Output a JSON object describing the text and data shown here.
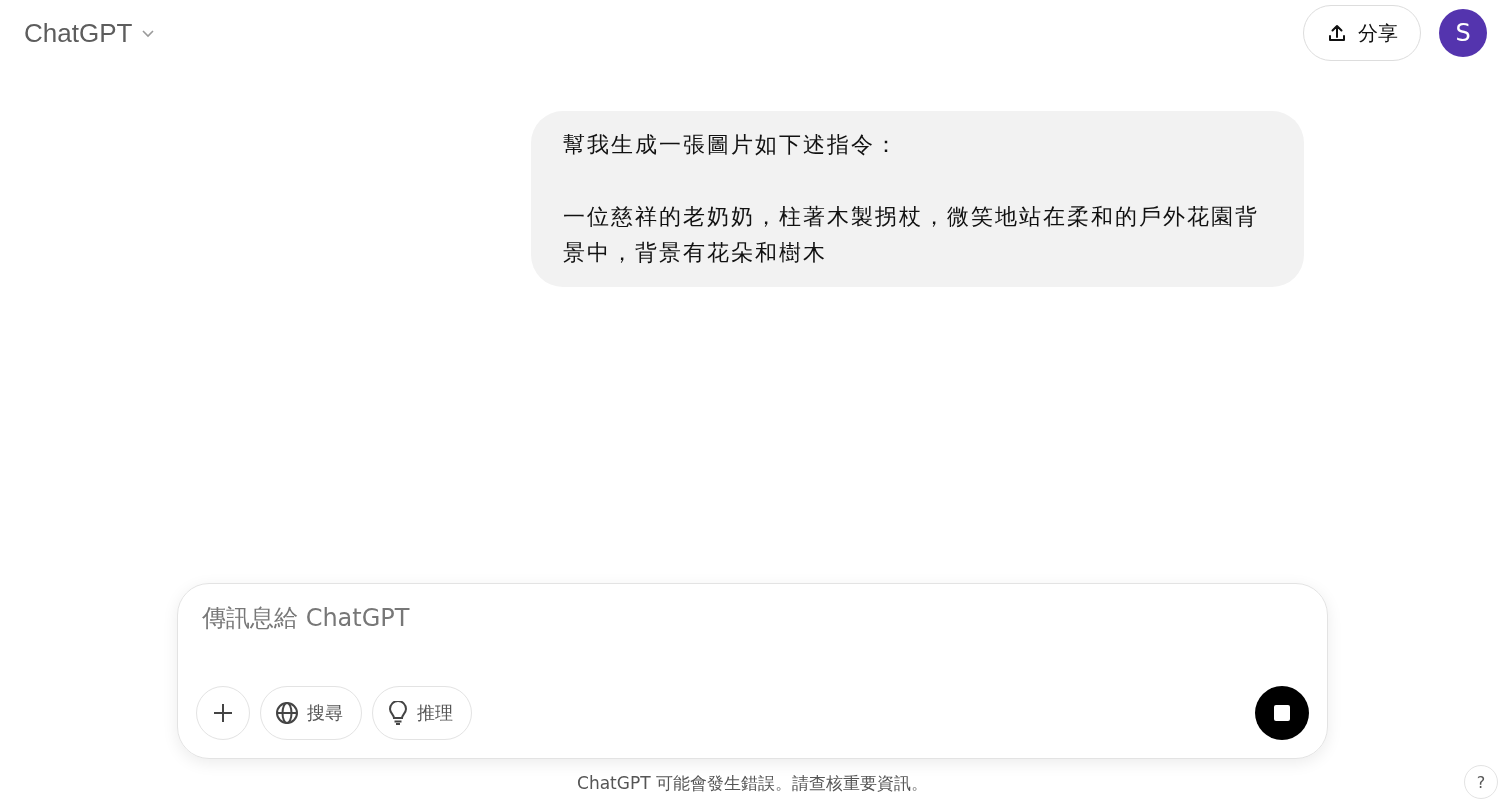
{
  "header": {
    "model": "ChatGPT",
    "share_button": "分享",
    "avatar": "S"
  },
  "messages": [
    {
      "paragraphs": [
        "幫我生成一張圖片如下述指令：",
        "一位慈祥的老奶奶，柱著木製拐杖，微笑地站在柔和的戶外花園背景中，背景有花朵和樹木"
      ]
    }
  ],
  "composer": {
    "placeholder": "傳訊息給 ChatGPT",
    "tools": [
      {
        "kind": "plus"
      },
      {
        "kind": "search",
        "label": "搜尋"
      },
      {
        "kind": "reason",
        "label": "推理"
      }
    ]
  },
  "disclaimer": "ChatGPT 可能會發生錯誤。請查核重要資訊。",
  "help_button": "?"
}
